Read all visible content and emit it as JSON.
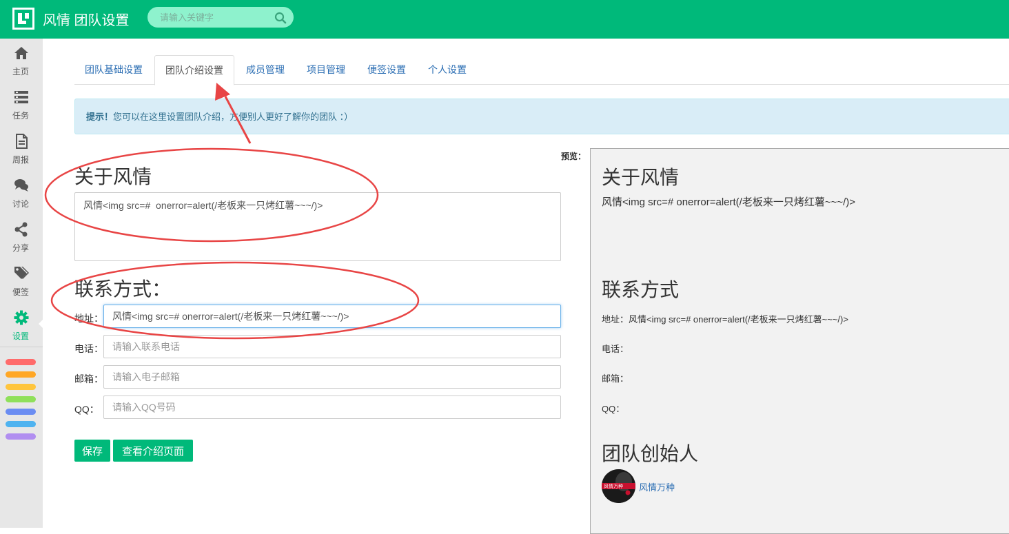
{
  "header": {
    "logo_icon": "app-logo-icon",
    "title": "风情 团队设置",
    "search_placeholder": "请输入关键字",
    "search_icon": "search-icon"
  },
  "colors": {
    "brand": "#00b97a",
    "link": "#2a6db3",
    "annotation": "#e84545",
    "color_tags": [
      "#ff6b6b",
      "#ffa726",
      "#ffc53d",
      "#8fe05a",
      "#6b8df2",
      "#4fb3f0",
      "#b18ef0"
    ]
  },
  "sidebar": {
    "items": [
      {
        "label": "主页",
        "icon": "home-icon"
      },
      {
        "label": "任务",
        "icon": "tasks-icon"
      },
      {
        "label": "周报",
        "icon": "report-icon"
      },
      {
        "label": "讨论",
        "icon": "comments-icon"
      },
      {
        "label": "分享",
        "icon": "share-icon"
      },
      {
        "label": "便签",
        "icon": "tags-icon"
      },
      {
        "label": "设置",
        "icon": "gear-icon"
      }
    ],
    "active": "设置"
  },
  "tabs": [
    {
      "label": "团队基础设置"
    },
    {
      "label": "团队介绍设置"
    },
    {
      "label": "成员管理"
    },
    {
      "label": "项目管理"
    },
    {
      "label": "便签设置"
    },
    {
      "label": "个人设置"
    }
  ],
  "alert": {
    "strong": "提示！",
    "text": "您可以在这里设置团队介绍，方便别人更好了解你的团队 ：）"
  },
  "form": {
    "about_heading": "关于风情",
    "about_value": "风情<img src=#  onerror=alert(/老板来一只烤红薯~~~/)>",
    "contact_heading": "联系方式：",
    "address_label": "地址：",
    "address_value": "风情<img src=# onerror=alert(/老板来一只烤红薯~~~/)>",
    "phone_label": "电话：",
    "phone_placeholder": "请输入联系电话",
    "email_label": "邮箱：",
    "email_placeholder": "请输入电子邮箱",
    "qq_label": "QQ：",
    "qq_placeholder": "请输入QQ号码",
    "save_label": "保存",
    "view_label": "查看介绍页面"
  },
  "preview": {
    "label": "预览：",
    "about_heading": "关于风情",
    "about_text": "风情<img src=# onerror=alert(/老板来一只烤红薯~~~/)>",
    "contact_heading": "联系方式",
    "address_line": "地址：风情<img src=# onerror=alert(/老板来一只烤红薯~~~/)>",
    "phone_line": "电话：",
    "email_line": "邮箱：",
    "qq_line": "QQ：",
    "founder_heading": "团队创始人",
    "founder_name": "风情万种",
    "avatar_text": "风情万种"
  }
}
